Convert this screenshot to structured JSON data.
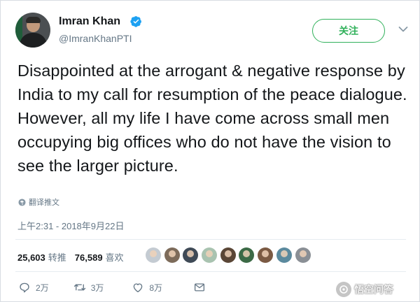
{
  "tweet": {
    "author": {
      "name": "Imran Khan",
      "handle": "@ImranKhanPTI",
      "verified": true
    },
    "follow_label": "关注",
    "text": "Disappointed at the arrogant & negative response by India to my call for resumption of the peace dialogue. However, all my life I have come across small men occupying big offices who do not have the vision to see the larger picture.",
    "translate_label": "翻译推文",
    "timestamp": "上午2:31 - 2018年9月22日",
    "stats": {
      "retweets_count": "25,603",
      "retweets_label": "转推",
      "likes_count": "76,589",
      "likes_label": "喜欢"
    },
    "likers": [
      "#c4cbd2",
      "#7d6b5a",
      "#3f4a56",
      "#a9c3b0",
      "#5a4636",
      "#3c6a46",
      "#7b5a43",
      "#5b8a9e",
      "#8a8f95"
    ],
    "actions": {
      "reply_count": "2万",
      "retweet_count": "3万",
      "like_count": "8万"
    }
  },
  "watermark": {
    "text": "悟空问答"
  },
  "colors": {
    "accent": "#31b15b",
    "verified": "#1da1f2",
    "muted": "#657786",
    "text": "#14171a"
  }
}
